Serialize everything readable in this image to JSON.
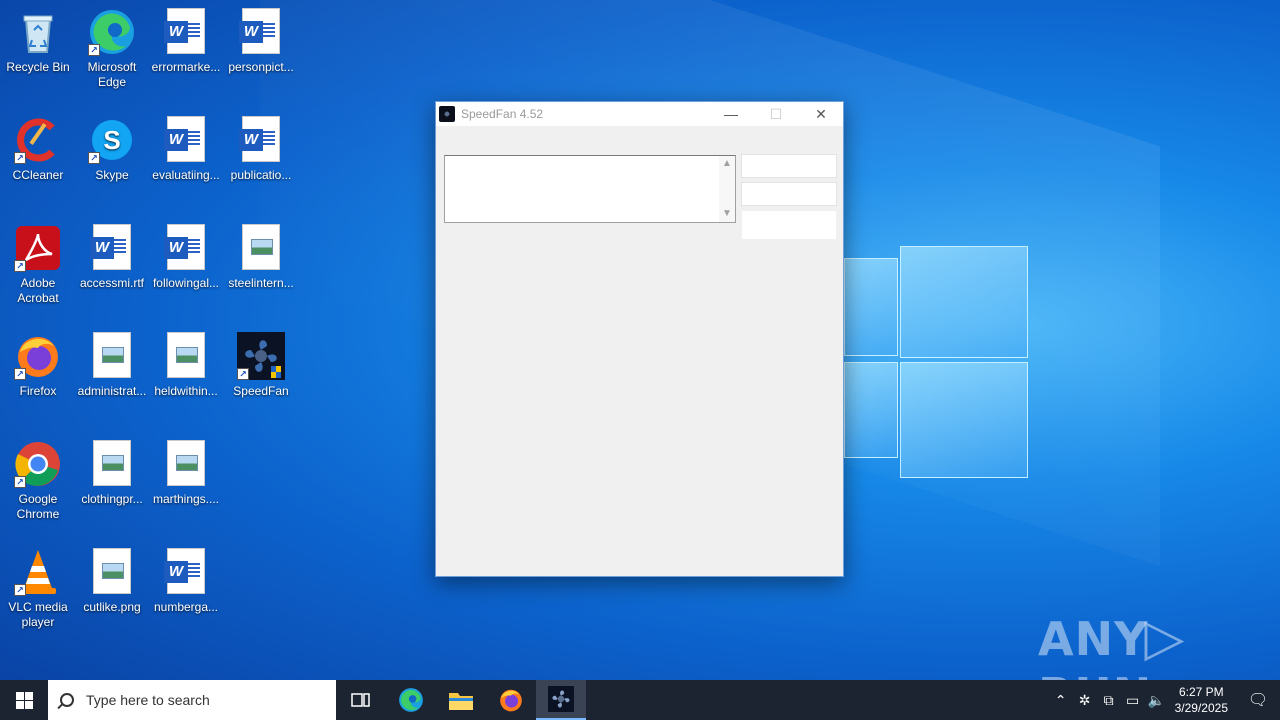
{
  "desktop": {
    "icons": [
      {
        "label": "Recycle Bin"
      },
      {
        "label": "Microsoft Edge"
      },
      {
        "label": "errormarke..."
      },
      {
        "label": "personpict..."
      },
      {
        "label": "CCleaner"
      },
      {
        "label": "Skype"
      },
      {
        "label": "evaluatiing..."
      },
      {
        "label": "publicatio..."
      },
      {
        "label": "Adobe Acrobat"
      },
      {
        "label": "accessmi.rtf"
      },
      {
        "label": "followingal..."
      },
      {
        "label": "steelintern..."
      },
      {
        "label": "Firefox"
      },
      {
        "label": "administrat..."
      },
      {
        "label": "heldwithin..."
      },
      {
        "label": "SpeedFan"
      },
      {
        "label": "Google Chrome"
      },
      {
        "label": "clothingpr..."
      },
      {
        "label": "marthings...."
      },
      {
        "label": "VLC media player"
      },
      {
        "label": "cutlike.png"
      },
      {
        "label": "numberga..."
      }
    ]
  },
  "window": {
    "title": "SpeedFan 4.52",
    "minimize": "—",
    "maximize": "☐",
    "close": "✕"
  },
  "watermark": {
    "left": "ANY",
    "right": "RUN"
  },
  "taskbar": {
    "search_placeholder": "Type here to search",
    "time": "6:27 PM",
    "date": "3/29/2025"
  },
  "colors": {
    "taskbar": "#1c2431",
    "window_bg": "#f0f0f0",
    "desktop": "#1789e8"
  }
}
